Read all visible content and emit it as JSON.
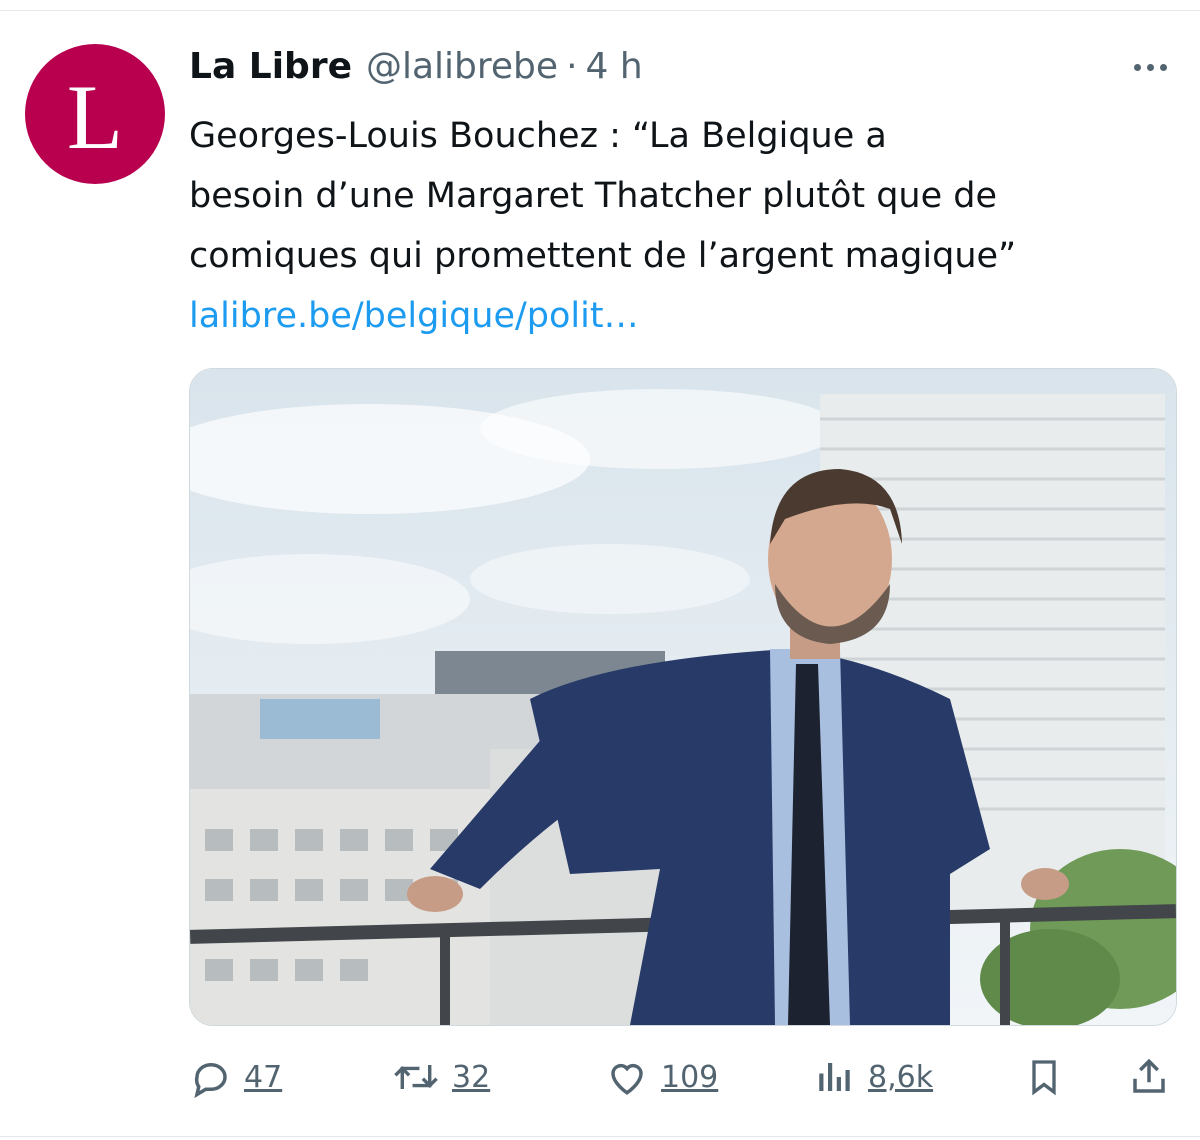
{
  "tweet": {
    "author_name": "La Libre",
    "author_handle": "@lalibrebe",
    "separator": "·",
    "timestamp": "4 h",
    "avatar_letter": "L",
    "text_lines": [
      "Georges-Louis Bouchez : “La Belgique a",
      "besoin d’une Margaret Thatcher plutôt que de",
      "comiques qui promettent de l’argent magique”"
    ],
    "link_text": "lalibre.be/belgique/polit…"
  },
  "actions": {
    "replies": "47",
    "retweets": "32",
    "likes": "109",
    "views": "8,6k"
  },
  "colors": {
    "brand": "#b8004f",
    "link": "#1d9bf0",
    "text_primary": "#0f1419",
    "text_secondary": "#536471"
  },
  "icons": {
    "more": "more-dots-icon",
    "reply": "reply-bubble-icon",
    "retweet": "retweet-icon",
    "like": "heart-icon",
    "views": "bar-chart-icon",
    "bookmark": "bookmark-icon",
    "share": "share-upload-icon"
  }
}
